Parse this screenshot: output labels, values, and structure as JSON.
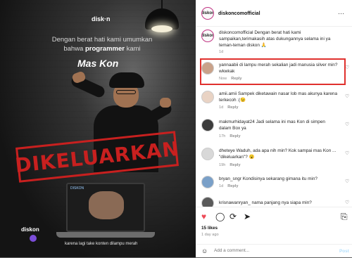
{
  "media": {
    "logo_text": "disk·n",
    "headline_line1": "Dengan berat hati kami umumkan",
    "headline_line2_pre": "bahwa ",
    "headline_line2_bold": "programmer",
    "headline_line2_post": " kami",
    "name": "Mas Kon",
    "stamp_text": "DIKELUARKAN",
    "laptop_tag": "DISKON",
    "caption": "karena lagi take konten dilampu merah",
    "logo_bottom": "diskon"
  },
  "header": {
    "avatar_text": "diskon",
    "username": "diskoncomofficial",
    "more": "···"
  },
  "caption_comment": {
    "avatar_text": "diskon",
    "text": "diskoncomofficial Dengan berat hati kami sampaikan,terimakasih atas dukungannya selama ini ya teman-teman diskon 🙏",
    "time": "1d"
  },
  "comments": [
    {
      "text": "yannaabii di lampu merah sekalian jadi manusia silver min? wkwkak",
      "time": "Now",
      "reply": "Reply",
      "avatar_color": "#c9a28a"
    },
    {
      "text": "amii.amii Sampek diketawain nasar lob mas akunya karena terkecoh :(😉",
      "time": "1d",
      "reply": "Reply",
      "avatar_color": "#e9d3c4"
    },
    {
      "text": "makmurhidayat24 Jadi selama ini mas Kon di simpen dalam Box ya",
      "time": "17h",
      "reply": "Reply",
      "avatar_color": "#3c3c3c"
    },
    {
      "text": "dheteye Waduh, ada apa nih min? Kok sampai mas Kon ... \"dikeluarkan\"? 😮",
      "time": "19h",
      "reply": "Reply",
      "avatar_color": "#d8d8d8"
    },
    {
      "text": "bryan_sngr Kondisinya sekarang gimana itu min?",
      "time": "1d",
      "reply": "Reply",
      "avatar_color": "#7aa0c8"
    },
    {
      "text": "krisnawanryan_ nama panjang nya siapa min?",
      "time": "",
      "reply": "",
      "avatar_color": "#5a5a5a"
    }
  ],
  "actions": {
    "likes": "15 likes",
    "ago": "1 day ago",
    "add_placeholder": "Add a comment...",
    "post_label": "Post"
  },
  "colors": {
    "highlight": "#e0302d",
    "stamp": "#c8201f",
    "like_red": "#ed4956",
    "post_blue": "#b2dffc"
  }
}
